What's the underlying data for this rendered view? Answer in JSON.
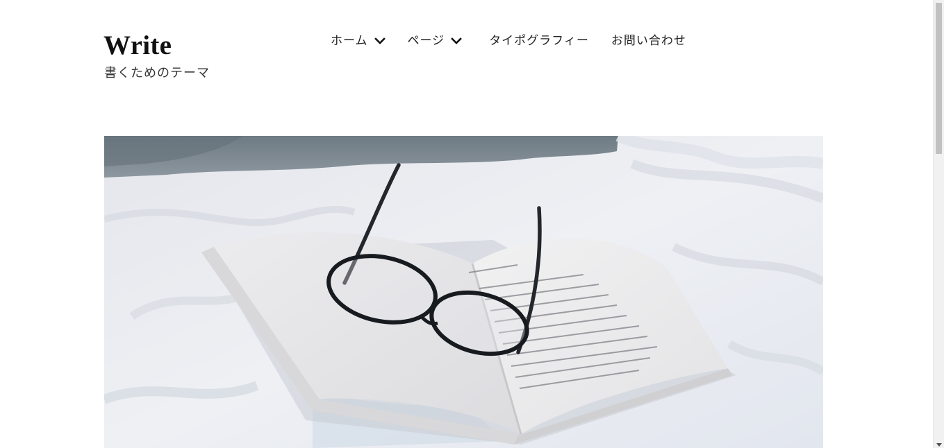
{
  "site": {
    "title": "Write",
    "description": "書くためのテーマ"
  },
  "nav": {
    "items": [
      {
        "label": "ホーム",
        "has_dropdown": true
      },
      {
        "label": "ページ",
        "has_dropdown": true
      },
      {
        "label": "タイポグラフィー",
        "has_dropdown": false
      },
      {
        "label": "お問い合わせ",
        "has_dropdown": false
      }
    ]
  },
  "hero": {
    "icon": "open-book-with-eyeglasses-photo"
  },
  "colors": {
    "text": "#222222",
    "background": "#ffffff",
    "scroll_thumb": "#c1c1c1"
  }
}
